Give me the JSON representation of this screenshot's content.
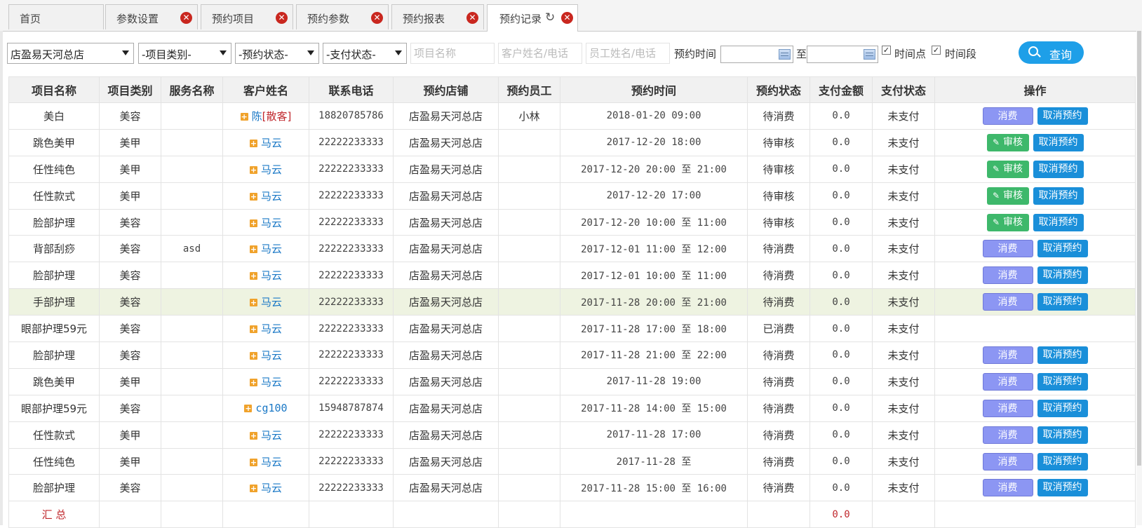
{
  "tabs": [
    {
      "label": "首页",
      "closable": false
    },
    {
      "label": "参数设置",
      "closable": true
    },
    {
      "label": "预约项目",
      "closable": true
    },
    {
      "label": "预约参数",
      "closable": true
    },
    {
      "label": "预约报表",
      "closable": true
    },
    {
      "label": "预约记录",
      "closable": true,
      "active": true
    }
  ],
  "icons": {
    "close": "close-icon",
    "refresh": "refresh-icon",
    "search": "search-icon",
    "calendar": "calendar-icon",
    "plus": "plus-icon",
    "pencil": "pencil-icon"
  },
  "filter": {
    "store": "店盈易天河总店",
    "category": "-项目类别-",
    "status": "-预约状态-",
    "pay_status": "-支付状态-",
    "project_placeholder": "项目名称",
    "customer_placeholder": "客户姓名/电话",
    "staff_placeholder": "员工姓名/电话",
    "time_label": "预约时间",
    "to_label": "至",
    "time_point_label": "时间点",
    "time_range_label": "时间段",
    "time_point_checked": true,
    "time_range_checked": true,
    "query_label": "查询"
  },
  "columns": [
    "项目名称",
    "项目类别",
    "服务名称",
    "客户姓名",
    "联系电话",
    "预约店铺",
    "预约员工",
    "预约时间",
    "预约状态",
    "支付金额",
    "支付状态",
    "操作"
  ],
  "rows": [
    {
      "project": "美白",
      "category": "美容",
      "service": "",
      "customer": "陈",
      "customer_tag": "[散客]",
      "phone": "18820785786",
      "store": "店盈易天河总店",
      "staff": "小林",
      "time": "2018-01-20 09:00",
      "status": "待消费",
      "amount": "0.0",
      "pay": "未支付",
      "actions": [
        "consume",
        "cancel"
      ]
    },
    {
      "project": "跳色美甲",
      "category": "美甲",
      "service": "",
      "customer": "马云",
      "customer_tag": "",
      "phone": "22222233333",
      "store": "店盈易天河总店",
      "staff": "",
      "time": "2017-12-20 18:00",
      "status": "待审核",
      "amount": "0.0",
      "pay": "未支付",
      "actions": [
        "audit",
        "cancel"
      ]
    },
    {
      "project": "任性纯色",
      "category": "美甲",
      "service": "",
      "customer": "马云",
      "customer_tag": "",
      "phone": "22222233333",
      "store": "店盈易天河总店",
      "staff": "",
      "time": "2017-12-20 20:00 至 21:00",
      "status": "待审核",
      "amount": "0.0",
      "pay": "未支付",
      "actions": [
        "audit",
        "cancel"
      ]
    },
    {
      "project": "任性款式",
      "category": "美甲",
      "service": "",
      "customer": "马云",
      "customer_tag": "",
      "phone": "22222233333",
      "store": "店盈易天河总店",
      "staff": "",
      "time": "2017-12-20 17:00",
      "status": "待审核",
      "amount": "0.0",
      "pay": "未支付",
      "actions": [
        "audit",
        "cancel"
      ]
    },
    {
      "project": "脸部护理",
      "category": "美容",
      "service": "",
      "customer": "马云",
      "customer_tag": "",
      "phone": "22222233333",
      "store": "店盈易天河总店",
      "staff": "",
      "time": "2017-12-20 10:00 至 11:00",
      "status": "待审核",
      "amount": "0.0",
      "pay": "未支付",
      "actions": [
        "audit",
        "cancel"
      ]
    },
    {
      "project": "背部刮痧",
      "category": "美容",
      "service": "asd",
      "customer": "马云",
      "customer_tag": "",
      "phone": "22222233333",
      "store": "店盈易天河总店",
      "staff": "",
      "time": "2017-12-01 11:00 至 12:00",
      "status": "待消费",
      "amount": "0.0",
      "pay": "未支付",
      "actions": [
        "consume",
        "cancel"
      ]
    },
    {
      "project": "脸部护理",
      "category": "美容",
      "service": "",
      "customer": "马云",
      "customer_tag": "",
      "phone": "22222233333",
      "store": "店盈易天河总店",
      "staff": "",
      "time": "2017-12-01 10:00 至 11:00",
      "status": "待消费",
      "amount": "0.0",
      "pay": "未支付",
      "actions": [
        "consume",
        "cancel"
      ]
    },
    {
      "project": "手部护理",
      "category": "美容",
      "service": "",
      "customer": "马云",
      "customer_tag": "",
      "phone": "22222233333",
      "store": "店盈易天河总店",
      "staff": "",
      "time": "2017-11-28 20:00 至 21:00",
      "status": "待消费",
      "amount": "0.0",
      "pay": "未支付",
      "actions": [
        "consume",
        "cancel"
      ],
      "highlight": true
    },
    {
      "project": "眼部护理59元",
      "category": "美容",
      "service": "",
      "customer": "马云",
      "customer_tag": "",
      "phone": "22222233333",
      "store": "店盈易天河总店",
      "staff": "",
      "time": "2017-11-28 17:00 至 18:00",
      "status": "已消费",
      "amount": "0.0",
      "pay": "未支付",
      "actions": []
    },
    {
      "project": "脸部护理",
      "category": "美容",
      "service": "",
      "customer": "马云",
      "customer_tag": "",
      "phone": "22222233333",
      "store": "店盈易天河总店",
      "staff": "",
      "time": "2017-11-28 21:00 至 22:00",
      "status": "待消费",
      "amount": "0.0",
      "pay": "未支付",
      "actions": [
        "consume",
        "cancel"
      ]
    },
    {
      "project": "跳色美甲",
      "category": "美甲",
      "service": "",
      "customer": "马云",
      "customer_tag": "",
      "phone": "22222233333",
      "store": "店盈易天河总店",
      "staff": "",
      "time": "2017-11-28 19:00",
      "status": "待消费",
      "amount": "0.0",
      "pay": "未支付",
      "actions": [
        "consume",
        "cancel"
      ]
    },
    {
      "project": "眼部护理59元",
      "category": "美容",
      "service": "",
      "customer": "cg100",
      "customer_tag": "",
      "phone": "15948787874",
      "store": "店盈易天河总店",
      "staff": "",
      "time": "2017-11-28 14:00 至 15:00",
      "status": "待消费",
      "amount": "0.0",
      "pay": "未支付",
      "actions": [
        "consume",
        "cancel"
      ]
    },
    {
      "project": "任性款式",
      "category": "美甲",
      "service": "",
      "customer": "马云",
      "customer_tag": "",
      "phone": "22222233333",
      "store": "店盈易天河总店",
      "staff": "",
      "time": "2017-11-28 17:00",
      "status": "待消费",
      "amount": "0.0",
      "pay": "未支付",
      "actions": [
        "consume",
        "cancel"
      ]
    },
    {
      "project": "任性纯色",
      "category": "美甲",
      "service": "",
      "customer": "马云",
      "customer_tag": "",
      "phone": "22222233333",
      "store": "店盈易天河总店",
      "staff": "",
      "time": "2017-11-28 至",
      "status": "待消费",
      "amount": "0.0",
      "pay": "未支付",
      "actions": [
        "consume",
        "cancel"
      ]
    },
    {
      "project": "脸部护理",
      "category": "美容",
      "service": "",
      "customer": "马云",
      "customer_tag": "",
      "phone": "22222233333",
      "store": "店盈易天河总店",
      "staff": "",
      "time": "2017-11-28 15:00 至 16:00",
      "status": "待消费",
      "amount": "0.0",
      "pay": "未支付",
      "actions": [
        "consume",
        "cancel"
      ]
    }
  ],
  "action_labels": {
    "consume": "消费",
    "audit": "审核",
    "cancel": "取消预约"
  },
  "total": {
    "label": "汇 总",
    "amount": "0.0"
  },
  "colors": {
    "accent": "#1e9fe8",
    "consume": "#8c96f3",
    "audit": "#3eb86b",
    "cancel": "#1a8fd9",
    "close": "#c9271f",
    "total": "#c0282d"
  }
}
